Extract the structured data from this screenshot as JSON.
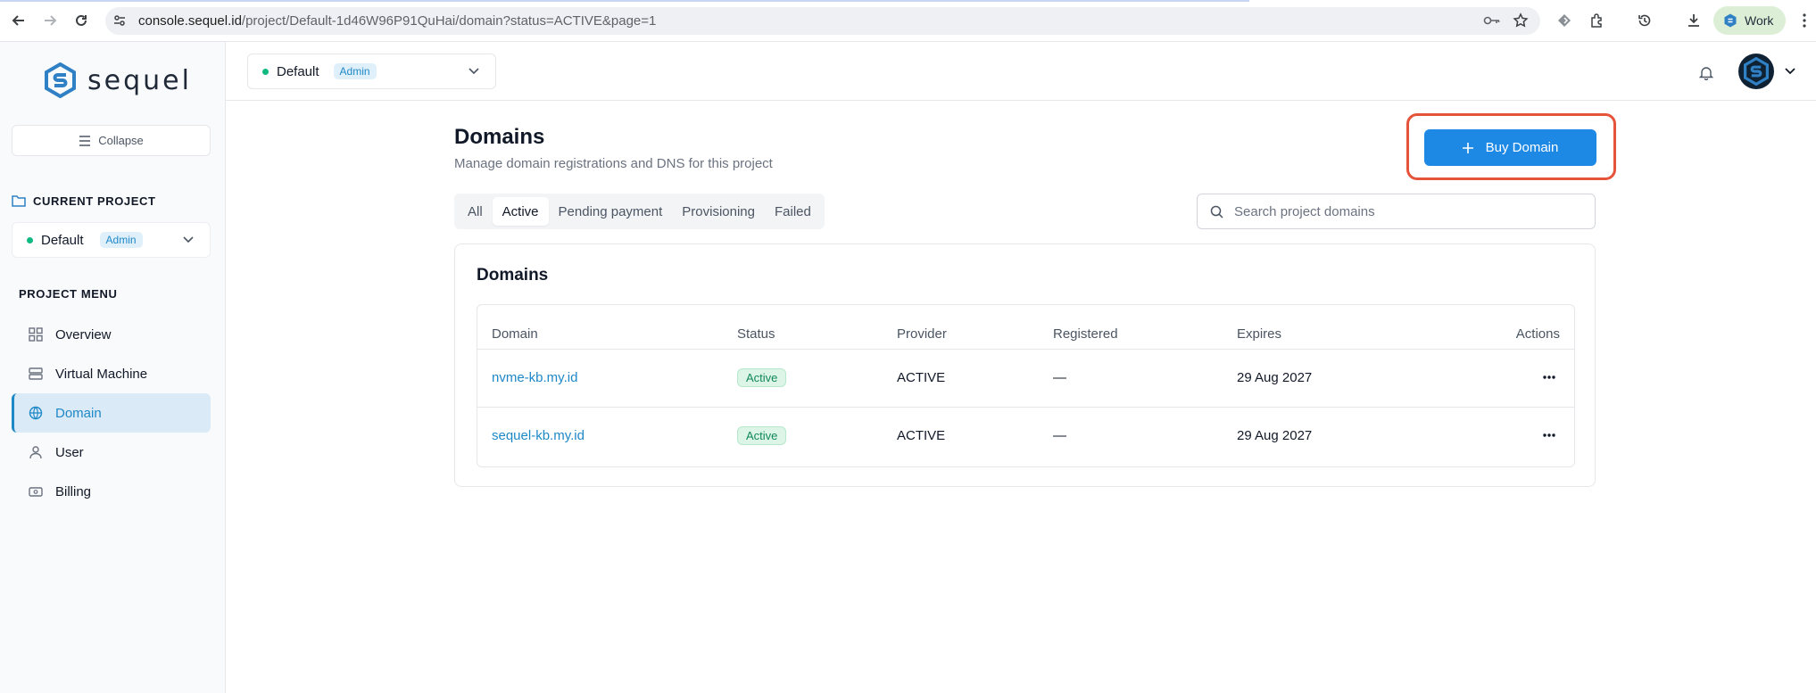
{
  "browser": {
    "url_host": "console.sequel.id",
    "url_path": "/project/Default-1d46W96P91QuHai/domain?status=ACTIVE&page=1",
    "profile_label": "Work"
  },
  "sidebar": {
    "logo_text": "sequel",
    "collapse_label": "Collapse",
    "current_project_label": "CURRENT PROJECT",
    "project_name": "Default",
    "project_role": "Admin",
    "menu_label": "PROJECT MENU",
    "items": [
      {
        "label": "Overview"
      },
      {
        "label": "Virtual Machine"
      },
      {
        "label": "Domain"
      },
      {
        "label": "User"
      },
      {
        "label": "Billing"
      }
    ]
  },
  "header": {
    "project_name": "Default",
    "project_role": "Admin"
  },
  "main": {
    "title": "Domains",
    "subtitle": "Manage domain registrations and DNS for this project",
    "buy_label": "Buy Domain",
    "tabs": [
      {
        "label": "All"
      },
      {
        "label": "Active"
      },
      {
        "label": "Pending payment"
      },
      {
        "label": "Provisioning"
      },
      {
        "label": "Failed"
      }
    ],
    "search_placeholder": "Search project domains",
    "card_title": "Domains",
    "columns": [
      "Domain",
      "Status",
      "Provider",
      "Registered",
      "Expires",
      "Actions"
    ],
    "rows": [
      {
        "domain": "nvme-kb.my.id",
        "status": "Active",
        "provider": "ACTIVE",
        "registered": "—",
        "expires": "29 Aug 2027"
      },
      {
        "domain": "sequel-kb.my.id",
        "status": "Active",
        "provider": "ACTIVE",
        "registered": "—",
        "expires": "29 Aug 2027"
      }
    ]
  },
  "colors": {
    "accent": "#1e88e5",
    "highlight": "#e5533a",
    "status_active": "#12885a"
  }
}
